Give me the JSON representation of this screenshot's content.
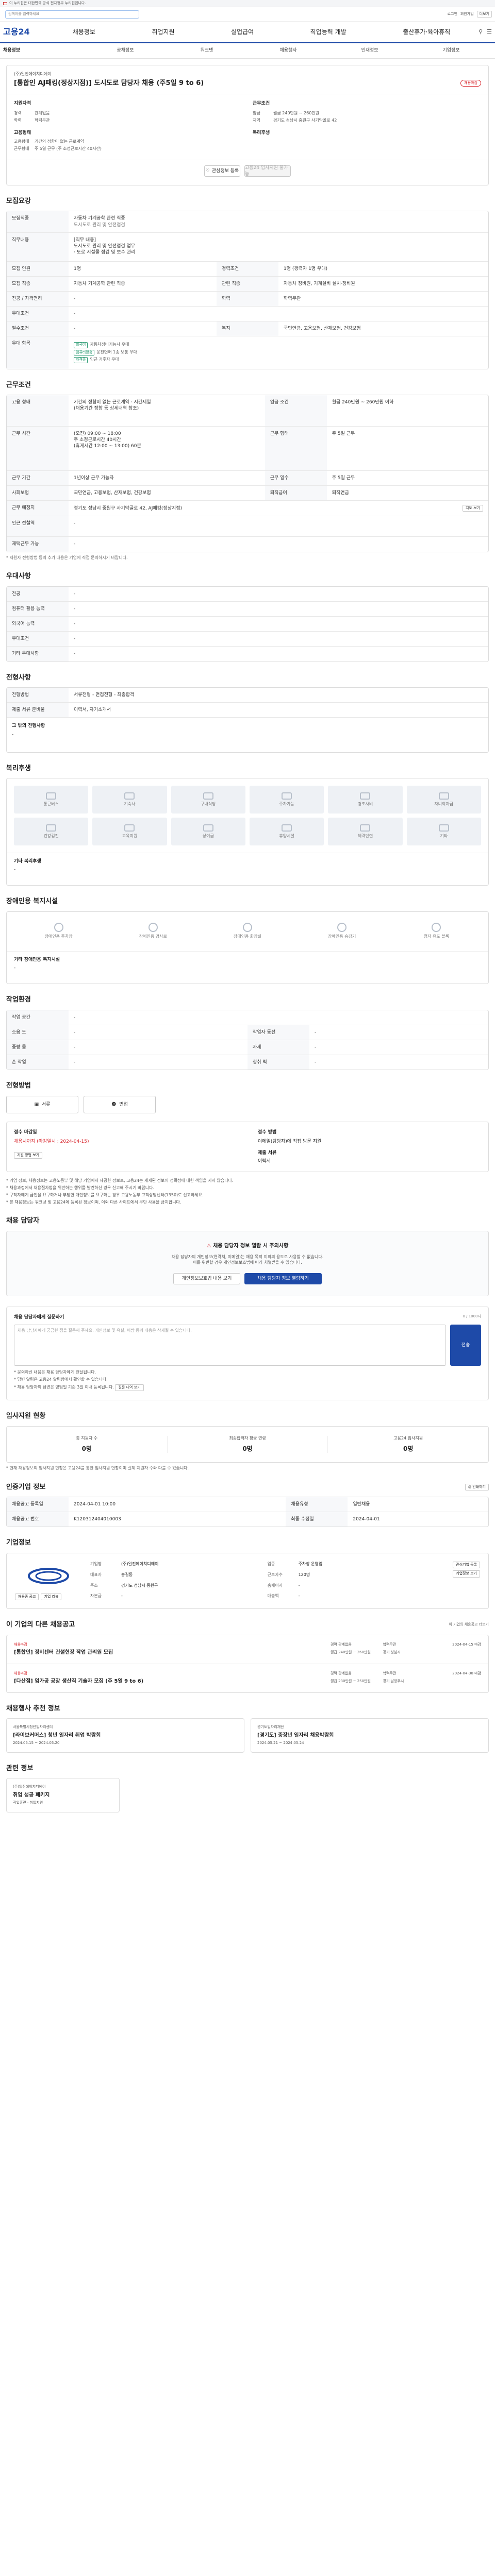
{
  "gov_banner": "이 누리집은 대한민국 공식 전자정부 누리집입니다.",
  "search": {
    "placeholder": "검색어를 입력하세요"
  },
  "util": {
    "login": "로그인",
    "join": "회원가입",
    "more": "더보기"
  },
  "logo": "고용24",
  "nav": [
    "채용정보",
    "취업지원",
    "실업급여",
    "직업능력 개발",
    "출산휴가·육아휴직"
  ],
  "nav_icons": [
    "검색",
    "전체메뉴"
  ],
  "subnav": [
    "채용정보",
    "공채정보",
    "워크넷",
    "채용행사",
    "인재정보",
    "기업정보"
  ],
  "job": {
    "company": "(주)일진에이치디에이",
    "title": "[통합인 AJ패킹(정상지점)] 도시도로 담당자 채용 (주5일 9 to 6)",
    "badge": "채용마감",
    "left_heading": "지원자격",
    "rows_left": [
      {
        "k": "경력",
        "v": "관계없음"
      },
      {
        "k": "학력",
        "v": "학력무관"
      }
    ],
    "right_heading": "근무조건",
    "rows_right": [
      {
        "k": "임금",
        "v": "월급 240만원 ~ 260만원"
      },
      {
        "k": "지역",
        "v": "경기도 성남시 중원구 사기막골로 42"
      }
    ],
    "left2_heading": "고용형태",
    "rows_left2": [
      {
        "k": "고용형태",
        "v": "기간의 정함이 없는 근로계약"
      },
      {
        "k": "근무형태",
        "v": "주 5일 근무 (주 소정근로시간 40시간)"
      }
    ],
    "right2_heading": "복리후생",
    "btn_scrap": "관심정보 등록",
    "btn_apply": "고용24 입사지원 불가능"
  },
  "recruit": {
    "heading": "모집요강",
    "duty_label": "모집직종",
    "duty": "자동차 기계공학 관련 직종",
    "duty_sub": "도시도로 관리 및 안전점검",
    "rows": [
      {
        "k": "직무내용",
        "v": "[직무 내용]\n도시도로 관리 및 안전점검 업무\n· 도로 시설물 점검 및 보수 관리"
      },
      {
        "k": "모집 인원",
        "v": "1명",
        "k2": "경력조건",
        "v2": "1명 (경력자 1명 우대)"
      },
      {
        "k": "모집 직종",
        "v": "자동차 기계공학 관련 직종",
        "k2": "관련 직종",
        "v2": "자동차 정비원, 기계설비 설치·정비원"
      },
      {
        "k": "전공 / 자격면허",
        "v": "-",
        "k2": "학력",
        "v2": "학력무관"
      },
      {
        "k": "우대조건",
        "v": "-"
      },
      {
        "k": "필수조건",
        "v": "-",
        "k2": "복지",
        "v2": "국민연금, 고용보험, 산재보험, 건강보험"
      }
    ],
    "prefer_label": "우대 항목",
    "prefer_chips": [
      "외국어",
      "컴퓨터활용",
      "자격증"
    ],
    "prefer_items": [
      "자동차정비기능사 우대",
      "운전면허 1종 보통 우대",
      "인근 거주자 우대"
    ]
  },
  "conditions": {
    "heading": "근무조건",
    "rows": [
      {
        "k": "고용 형태",
        "v": "기간의 정함이 없는 근로계약 · 시간제일\n(채용기간 정함 등 상세내역 참조)",
        "k2": "임금 조건",
        "v2": "월급 240만원 ~ 260만원 이하"
      },
      {
        "k": "근무 시간",
        "v": "(오전) 09:00 ~ 18:00\n주 소정근로시간 40시간\n(휴게시간 12:00 ~ 13:00) 60분",
        "k2": "근무 형태",
        "v2": "주 5일 근무"
      },
      {
        "k": "근무 기간",
        "v": "1년이상 근무 가능자",
        "k2": "근무 일수",
        "v2": "주 5일 근무"
      },
      {
        "k": "사회보험",
        "v": "국민연금, 고용보험, 산재보험, 건강보험",
        "k2": "퇴직급여",
        "v2": "퇴직연금"
      },
      {
        "k": "근무 예정지",
        "v": "경기도 성남시 중원구 사기막골로 42, AJ패킹(정상지점)",
        "k2": "",
        "v2": ""
      },
      {
        "k": "인근 전철역",
        "v": "-"
      },
      {
        "k": "재택근무 가능",
        "v": "-"
      }
    ],
    "map_btn": "지도 보기",
    "note": "* 지원자 전형방법 등의 추가 내용은 기업에 직접 문의하시기 바랍니다."
  },
  "process": {
    "heading": "우대사항",
    "rows": [
      {
        "k": "전공",
        "v": "-"
      },
      {
        "k": "컴퓨터 활용 능력",
        "v": "-"
      },
      {
        "k": "외국어 능력",
        "v": "-"
      },
      {
        "k": "우대조건",
        "v": "-"
      },
      {
        "k": "기타 우대사항",
        "v": "-"
      }
    ]
  },
  "selection": {
    "heading": "전형사항",
    "rows": [
      {
        "k": "전형방법",
        "v": "서류전형 - 면접전형 - 최종합격"
      },
      {
        "k": "제출 서류 준비물",
        "v": "이력서, 자기소개서"
      }
    ],
    "extra_label": "그 밖의 전형사항",
    "extra": "-"
  },
  "welfare": {
    "heading": "복리후생",
    "items": [
      "통근버스",
      "기숙사",
      "구내식당",
      "주차가능",
      "경조사비",
      "자녀학자금",
      "건강검진",
      "교육지원",
      "상여금",
      "휴양시설",
      "체력단련",
      "기타"
    ],
    "extra_label": "기타 복리후생",
    "extra": "-"
  },
  "disability": {
    "heading": "장애인용 복지시설",
    "items": [
      "장애인용 주차장",
      "장애인용 경사로",
      "장애인용 화장실",
      "장애인용 승강기",
      "점자 유도 블록"
    ],
    "extra_label": "기타 장애인용 복지시설",
    "extra": "-"
  },
  "workenv": {
    "heading": "작업환경",
    "rows": [
      {
        "k": "작업 공간",
        "v": "-",
        "k2": "",
        "v2": ""
      },
      {
        "k": "소음 도",
        "v": "-",
        "k2": "작업자 동선",
        "v2": "-"
      },
      {
        "k": "중량 물",
        "v": "-",
        "k2": "자세",
        "v2": "-"
      },
      {
        "k": "손 작업",
        "v": "-",
        "k2": "청취 력",
        "v2": "-"
      }
    ]
  },
  "apply_method": {
    "heading": "전형방법",
    "tabs": [
      "서류",
      "면접"
    ]
  },
  "deadline": {
    "receive_label": "접수 마감일",
    "receive_value": "채용시까지 (마감일시 : 2024-04-15)",
    "method_label": "접수 방법",
    "method_value": "이메일(담당자)에 직접 방문 지원",
    "btn": "지원 방법 보기",
    "docs_label": "제출 서류",
    "docs_value": "이력서"
  },
  "notes": [
    "* 기업 정보, 채용정보는 고용노동부 및 해당 기업에서 제공한 정보로, 고용24는 게재된 정보의 정확성에 대한 책임을 지지 않습니다.",
    "* 채용과정에서 채용절차법을 위반하는 행위를 발견하신 경우 신고해 주시기 바랍니다.",
    "* 구직자에게 금전을 요구하거나 부당한 개인정보를 요구하는 경우 고용노동부 고객상담센터(1350)로 신고하세요.",
    "* 본 채용정보는 워크넷 및 고용24에 등록된 정보이며, 이외 다른 사이트에서 무단 사용을 금지합니다."
  ],
  "contact": {
    "heading": "채용 담당자",
    "alert": "채용 담당자 정보 열람 시 주의사항",
    "alert_body": "채용 담당자의 개인정보(연락처, 이메일)는 채용 목적 이외의 용도로 사용할 수 없습니다.\n이를 위반할 경우 개인정보보호법에 따라 처벌받을 수 있습니다.",
    "btn_agree": "개인정보보호법 내용 보기",
    "btn_view": "채용 담당자 정보 열람하기"
  },
  "inquiry": {
    "heading": "채용 담당자에게 질문하기",
    "counter": "0 / 1000자",
    "placeholder": "채용 담당자에게 궁금한 점을 질문해 주세요. 개인정보 및 욕설, 비방 등의 내용은 삭제될 수 있습니다.",
    "submit": "전송",
    "notes": [
      "* 문의하신 내용은 채용 담당자에게 전달됩니다.",
      "* 답변 알림은 고용24 알림함에서 확인할 수 있습니다.",
      "* 채용 담당자의 답변은 영업일 기준 3일 이내 등록됩니다."
    ],
    "notes_btn": "질문 내역 보기"
  },
  "stats": {
    "heading": "입사지원 현황",
    "items": [
      {
        "label": "총 지원자 수",
        "value": "0명"
      },
      {
        "label": "최종합격자 평균 연령",
        "value": "0명"
      },
      {
        "label": "고용24 입사지원",
        "value": "0명"
      }
    ],
    "note": "* 현재 채용정보의 입사지원 현황은 고용24를 통한 입사지원 현황이며 실제 지원자 수와 다를 수 있습니다."
  },
  "info": {
    "heading": "인증기업 정보",
    "print_btn": "인쇄하기",
    "rows": [
      {
        "k": "채용공고 등록일",
        "v": "2024-04-01 10:00",
        "k2": "채용유형",
        "v2": "일반채용"
      },
      {
        "k": "채용공고 번호",
        "v": "K120312404010003",
        "k2": "최종 수정일",
        "v2": "2024-04-01"
      }
    ]
  },
  "company": {
    "heading": "기업정보",
    "name": "(주)일진에이치디에이",
    "rows": [
      {
        "k": "기업명",
        "v": "(주)일진에이치디에이",
        "k2": "업종",
        "v2": "주차장 운영업"
      },
      {
        "k": "대표자",
        "v": "홍길동",
        "k2": "근로자수",
        "v2": "120명"
      },
      {
        "k": "주소",
        "v": "경기도 성남시 중원구",
        "k2": "홈페이지",
        "v2": "-"
      },
      {
        "k": "자본금",
        "v": "-",
        "k2": "매출액",
        "v2": "-"
      }
    ],
    "btns": [
      "관심기업 등록",
      "기업정보 보기"
    ],
    "logo_btns": [
      "채용중 공고",
      "기업 리뷰"
    ]
  },
  "similar": {
    "heading": "이 기업의 다른 채용공고",
    "more": "이 기업의 채용공고 더보기",
    "items": [
      {
        "company": "채용마감",
        "title": "[통합인] 정비센터 건설현장 작업 관리원 모집",
        "meta": [
          "경력 관계없음",
          "학력무관",
          "월급 240만원 ~ 260만원",
          "경기 성남시"
        ],
        "date": "2024-04-15 마감"
      },
      {
        "company": "채용마감",
        "title": "[다산점] 임가공 공장 생산직 기술자 모집 (주 5일 9 to 6)",
        "meta": [
          "경력 관계없음",
          "학력무관",
          "월급 230만원 ~ 250만원",
          "경기 남양주시"
        ],
        "date": "2024-04-30 마감"
      }
    ]
  },
  "recommend": {
    "heading": "채용행사 추천 정보",
    "items": [
      {
        "org": "서울특별시청년일자리센터",
        "title": "[라이브커머스] 청년 일자리 취업 박람회",
        "date": "2024.05.15 ~ 2024.05.20"
      },
      {
        "org": "경기도일자리재단",
        "title": "[경기도] 중장년 일자리 채용박람회",
        "date": "2024.05.21 ~ 2024.05.24"
      }
    ]
  },
  "related": {
    "heading": "관련 정보",
    "items": [
      {
        "org": "(주)일진에이치디에이",
        "title": "취업 성공 패키지",
        "meta": [
          "직업훈련",
          "취업지원"
        ]
      }
    ]
  }
}
